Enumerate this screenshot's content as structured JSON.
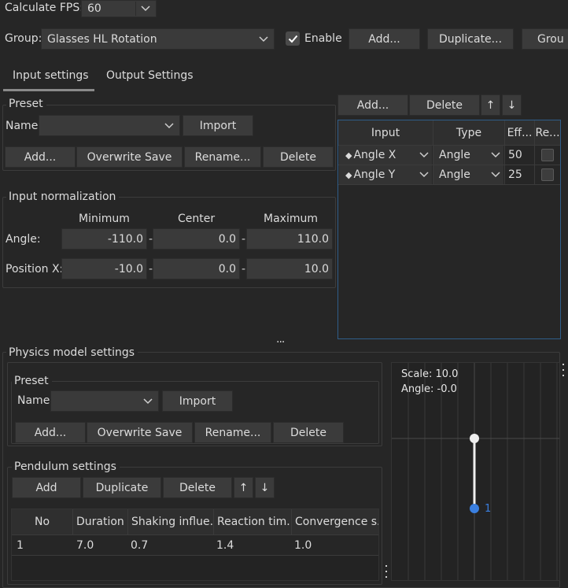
{
  "top": {
    "fps_label": "Calculate FPS:",
    "fps_value": "60",
    "group_label": "Group:",
    "group_value": "Glasses HL Rotation",
    "enable_label": "Enable",
    "enable_checked": true,
    "add_label": "Add...",
    "duplicate_label": "Duplicate...",
    "group_button_label": "Grou"
  },
  "tabs": [
    "Input settings",
    "Output Settings"
  ],
  "input_preset": {
    "title": "Preset",
    "name_label": "Name:",
    "name_value": "",
    "import_label": "Import",
    "add_label": "Add...",
    "overwrite_label": "Overwrite Save",
    "rename_label": "Rename...",
    "delete_label": "Delete"
  },
  "normalization": {
    "title": "Input normalization",
    "col_min": "Minimum",
    "col_center": "Center",
    "col_max": "Maximum",
    "dash": "-",
    "rows": [
      {
        "label": "Angle:",
        "min": "-110.0",
        "center": "0.0",
        "max": "110.0"
      },
      {
        "label": "Position X:",
        "min": "-10.0",
        "center": "0.0",
        "max": "10.0"
      }
    ]
  },
  "input_list": {
    "add_label": "Add...",
    "delete_label": "Delete",
    "up_label": "↑",
    "down_label": "↓",
    "headers": [
      "Input",
      "Type",
      "Eff...",
      "Re..."
    ],
    "rows": [
      {
        "input": "Angle X",
        "type": "Angle",
        "effect": "50",
        "reverse": false
      },
      {
        "input": "Angle Y",
        "type": "Angle",
        "effect": "25",
        "reverse": false
      }
    ]
  },
  "splitter_glyph": "...",
  "physics": {
    "title": "Physics model settings",
    "preset": {
      "title": "Preset",
      "name_label": "Name:",
      "name_value": "",
      "import_label": "Import",
      "add_label": "Add...",
      "overwrite_label": "Overwrite Save",
      "rename_label": "Rename...",
      "delete_label": "Delete"
    },
    "pendulum": {
      "title": "Pendulum settings",
      "add_label": "Add",
      "duplicate_label": "Duplicate",
      "delete_label": "Delete",
      "up_label": "↑",
      "down_label": "↓",
      "headers": [
        "No",
        "Duration",
        "Shaking influe...",
        "Reaction tim...",
        "Convergence s..."
      ],
      "rows": [
        {
          "no": "1",
          "duration": "7.0",
          "shaking": "0.7",
          "reaction": "1.4",
          "convergence": "1.0"
        }
      ]
    },
    "preview": {
      "scale_text": "Scale: 10.0",
      "angle_text": "Angle: -0.0",
      "node_label": "1",
      "node_color": "#3a7fe0"
    }
  },
  "colors": {
    "background": "#262626",
    "accent": "#3a7fe0",
    "tab_underline": "#8a8a8a",
    "selection_border": "#2f5d8a"
  }
}
